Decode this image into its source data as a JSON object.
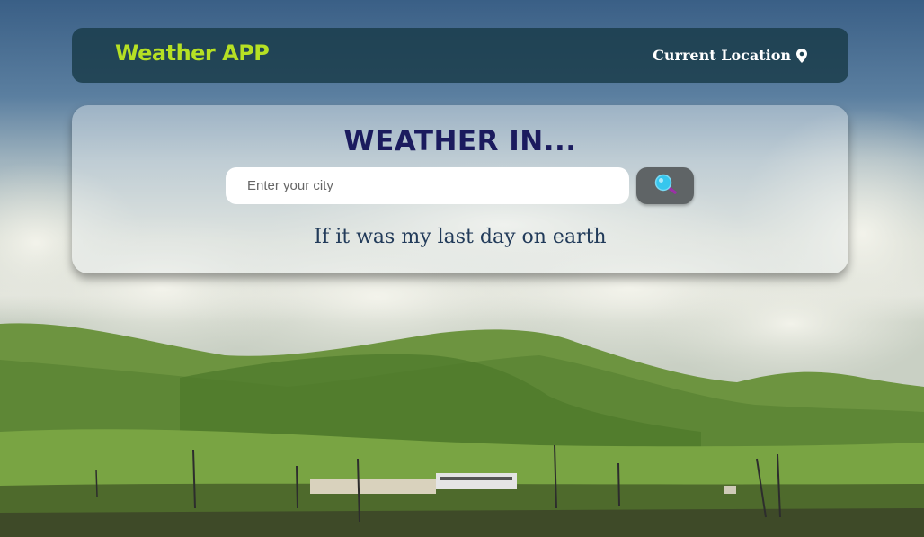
{
  "navbar": {
    "brand": "Weather APP",
    "location_label": "Current Location",
    "location_icon": "map-pin-icon"
  },
  "search_panel": {
    "heading": "WEATHER IN...",
    "input": {
      "placeholder": "Enter your city",
      "value": ""
    },
    "search_icon": "magnifier-icon",
    "quote": "If it was my last day on earth"
  },
  "colors": {
    "brand": "#b6e024",
    "navbar_bg": "#183a48",
    "heading": "#1b1b5e",
    "quote": "#223b5a",
    "search_button_bg": "#5f6466"
  }
}
